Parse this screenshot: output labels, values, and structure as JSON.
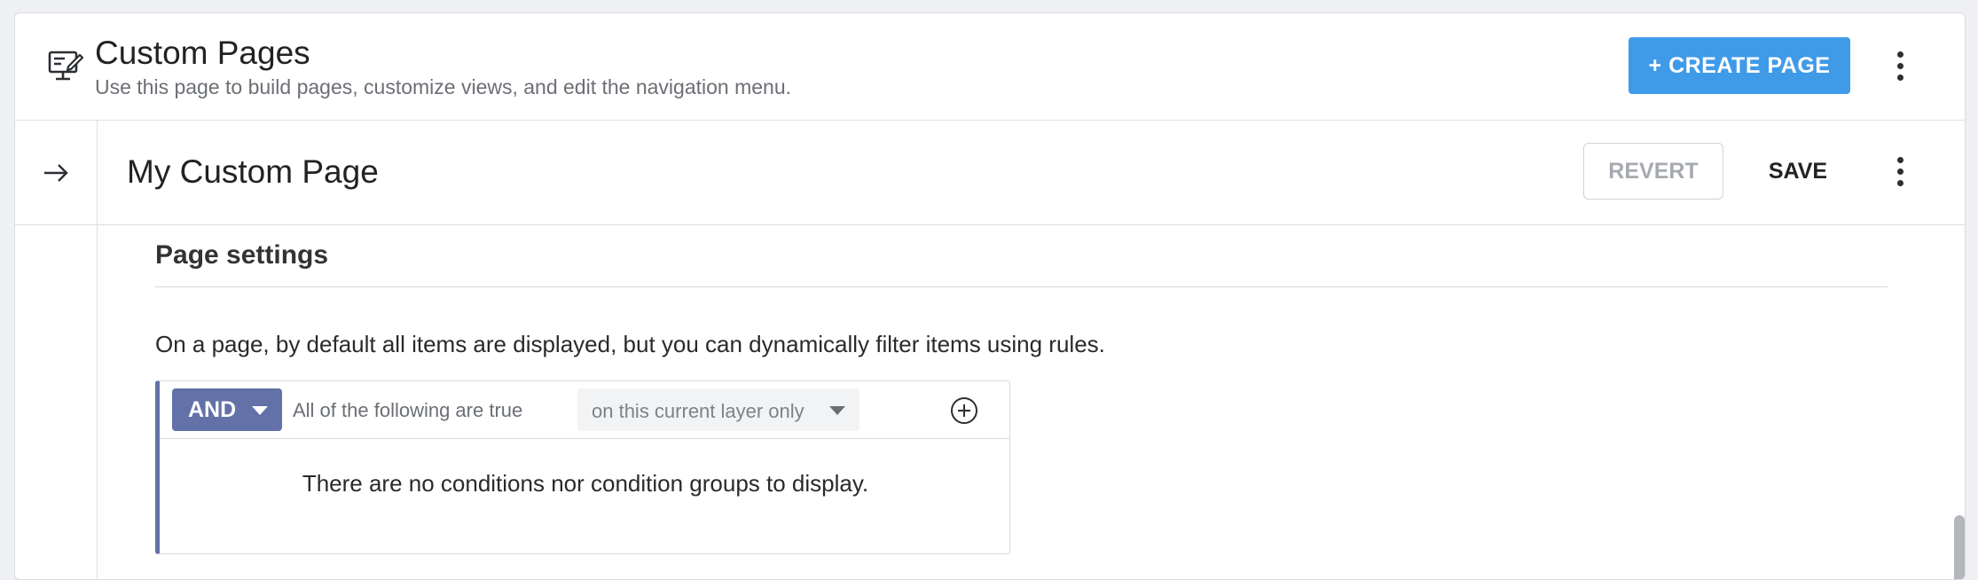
{
  "header": {
    "icon": "monitor-edit-icon",
    "title": "Custom Pages",
    "subtitle": "Use this page to build pages, customize views, and edit the navigation menu.",
    "create_label": "+ CREATE PAGE",
    "more_icon": "more-vertical-icon"
  },
  "page_bar": {
    "expand_icon": "arrow-right-icon",
    "title": "My Custom Page",
    "revert_label": "REVERT",
    "save_label": "SAVE",
    "more_icon": "more-vertical-icon"
  },
  "settings": {
    "title": "Page settings",
    "intro": "On a page, by default all items are displayed, but you can dynamically filter items using rules.",
    "rule": {
      "operator": "AND",
      "description": "All of the following are true",
      "scope": "on this current layer only",
      "add_icon": "plus-circle-icon",
      "empty_message": "There are no conditions nor condition groups to display."
    }
  },
  "colors": {
    "primary": "#3f9ae8",
    "rule_accent": "#6271a8",
    "disabled_text": "#a6aab0"
  }
}
